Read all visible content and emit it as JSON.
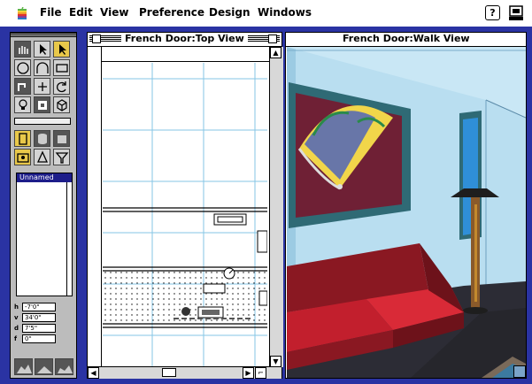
{
  "menubar": {
    "items": [
      "File",
      "Edit",
      "View",
      "Preference",
      "Design",
      "Windows"
    ],
    "help_label": "?"
  },
  "palette": {
    "name_panel_title": "Unnamed",
    "coordinates": [
      {
        "axis": "h",
        "value": "-7'0\""
      },
      {
        "axis": "v",
        "value": "34'0\""
      },
      {
        "axis": "d",
        "value": "7'5\""
      },
      {
        "axis": "f",
        "value": "0\""
      }
    ]
  },
  "top_view": {
    "title": "French Door:Top View"
  },
  "walk_view": {
    "title": "French Door:Walk View"
  },
  "colors": {
    "desktop": "#2a33a3",
    "wall": "#b9def0",
    "floor": "#2c2c35",
    "sofa": "#c21f2d",
    "frame": "#2f6a75",
    "lamp": "#8a5a2a"
  }
}
